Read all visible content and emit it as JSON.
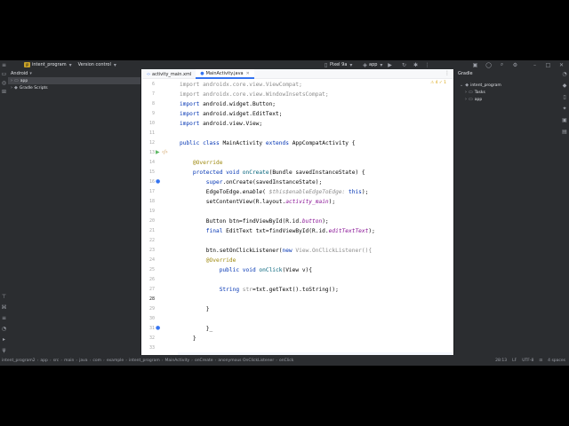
{
  "titlebar": {
    "project_badge": "IP",
    "project_name": "intent_program",
    "vcs": "Version control",
    "device": "Pixel 9a",
    "run_config": "app"
  },
  "project_panel": {
    "title": "Android",
    "items": [
      {
        "label": "app"
      },
      {
        "label": "Gradle Scripts"
      }
    ]
  },
  "tabs": [
    {
      "label": "activity_main.xml"
    },
    {
      "label": "MainActivity.java"
    }
  ],
  "editor": {
    "warnings": "⚠ 4  ✓ 1",
    "lines": [
      {
        "n": "6",
        "segments": [
          {
            "t": "import androidx.core.view.ViewCompat;",
            "c": "grey"
          }
        ]
      },
      {
        "n": "7",
        "segments": [
          {
            "t": "import androidx.core.view.WindowInsetsCompat;",
            "c": "grey"
          }
        ]
      },
      {
        "n": "8",
        "segments": [
          {
            "t": "import ",
            "c": "kw"
          },
          {
            "t": "android.widget.Button;",
            "c": ""
          }
        ]
      },
      {
        "n": "9",
        "segments": [
          {
            "t": "import ",
            "c": "kw"
          },
          {
            "t": "android.widget.EditText;",
            "c": ""
          }
        ]
      },
      {
        "n": "10",
        "segments": [
          {
            "t": "import ",
            "c": "kw"
          },
          {
            "t": "android.view.View;",
            "c": ""
          }
        ]
      },
      {
        "n": "11",
        "segments": []
      },
      {
        "n": "12",
        "segments": [
          {
            "t": "public class ",
            "c": "kw"
          },
          {
            "t": "MainActivity ",
            "c": ""
          },
          {
            "t": "extends ",
            "c": "kw"
          },
          {
            "t": "AppCompatActivity {",
            "c": ""
          }
        ]
      },
      {
        "n": "13",
        "segments": []
      },
      {
        "n": "14",
        "segments": [
          {
            "t": "    @Override",
            "c": "ann"
          }
        ]
      },
      {
        "n": "15",
        "segments": [
          {
            "t": "    protected void ",
            "c": "kw"
          },
          {
            "t": "onCreate",
            "c": "fn"
          },
          {
            "t": "(Bundle savedInstanceState) {",
            "c": ""
          }
        ]
      },
      {
        "n": "16",
        "segments": [
          {
            "t": "        super",
            "c": "kw"
          },
          {
            "t": ".onCreate(savedInstanceState);",
            "c": ""
          }
        ]
      },
      {
        "n": "17",
        "segments": [
          {
            "t": "        EdgeToEdge.",
            "c": ""
          },
          {
            "t": "enable",
            "c": "it"
          },
          {
            "t": "( ",
            "c": ""
          },
          {
            "t": "$this$enableEdgeToEdge: ",
            "c": "hint"
          },
          {
            "t": "this",
            "c": "kw"
          },
          {
            "t": ");",
            "c": ""
          }
        ]
      },
      {
        "n": "18",
        "segments": [
          {
            "t": "        setContentView(R.layout.",
            "c": ""
          },
          {
            "t": "activity_main",
            "c": "fld"
          },
          {
            "t": ");",
            "c": ""
          }
        ]
      },
      {
        "n": "19",
        "segments": []
      },
      {
        "n": "20",
        "segments": [
          {
            "t": "        Button btn=findViewById(R.id.",
            "c": ""
          },
          {
            "t": "button",
            "c": "fld"
          },
          {
            "t": ");",
            "c": ""
          }
        ]
      },
      {
        "n": "21",
        "segments": [
          {
            "t": "        final ",
            "c": "kw"
          },
          {
            "t": "EditText txt=findViewById(R.id.",
            "c": ""
          },
          {
            "t": "editTextText",
            "c": "fld"
          },
          {
            "t": ");",
            "c": ""
          }
        ]
      },
      {
        "n": "22",
        "segments": []
      },
      {
        "n": "23",
        "segments": [
          {
            "t": "        btn.setOnClickListener(",
            "c": ""
          },
          {
            "t": "new ",
            "c": "kw"
          },
          {
            "t": "View.OnClickListener(){",
            "c": "grey"
          }
        ]
      },
      {
        "n": "24",
        "segments": [
          {
            "t": "        @Override",
            "c": "ann"
          }
        ]
      },
      {
        "n": "25",
        "segments": [
          {
            "t": "            public void ",
            "c": "kw"
          },
          {
            "t": "onClick",
            "c": "fn"
          },
          {
            "t": "(View v){",
            "c": ""
          }
        ]
      },
      {
        "n": "26",
        "segments": []
      },
      {
        "n": "27",
        "segments": [
          {
            "t": "            String ",
            "c": "kw"
          },
          {
            "t": "str",
            "c": "grey"
          },
          {
            "t": "=txt.getText().toString();",
            "c": ""
          }
        ]
      },
      {
        "n": "28",
        "segments": []
      },
      {
        "n": "29",
        "segments": [
          {
            "t": "        }",
            "c": ""
          }
        ]
      },
      {
        "n": "30",
        "segments": []
      },
      {
        "n": "31",
        "segments": [
          {
            "t": "        }_",
            "c": ""
          }
        ]
      },
      {
        "n": "32",
        "segments": [
          {
            "t": "    }",
            "c": ""
          }
        ]
      },
      {
        "n": "33",
        "segments": []
      }
    ],
    "current_line": "28"
  },
  "gradle_panel": {
    "title": "Gradle",
    "items": [
      {
        "label": "intent_program"
      },
      {
        "label": "Tasks"
      },
      {
        "label": "app"
      }
    ]
  },
  "statusbar": {
    "breadcrumbs": [
      "intent_program2",
      "app",
      "src",
      "main",
      "java",
      "com",
      "example",
      "intent_program",
      "MainActivity",
      "onCreate",
      "anonymous OnClickListener",
      "onClick"
    ],
    "position": "28:13",
    "line_sep": "LF",
    "encoding": "UTF-8",
    "indent": "4 spaces"
  }
}
